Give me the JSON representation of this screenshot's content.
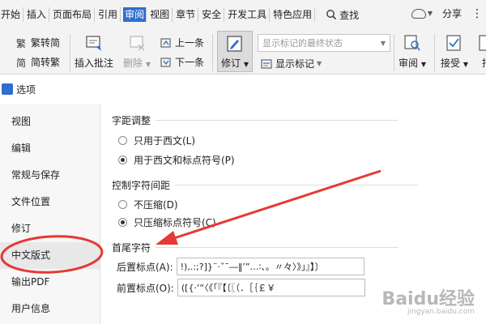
{
  "menubar": {
    "tabs": [
      "开始",
      "插入",
      "页面布局",
      "引用",
      "审阅",
      "视图",
      "章节",
      "安全",
      "开发工具",
      "特色应用"
    ],
    "active_tab": "审阅",
    "find_label": "查找",
    "share_label": "分享"
  },
  "toolbar": {
    "trad_to_simp": "繁转简",
    "simp_to_trad": "简转繁",
    "insert_comment": "插入批注",
    "delete": "删除",
    "previous": "上一条",
    "next": "下一条",
    "revise": "修订",
    "show_state_value": "显示标记的最终状态",
    "show_markup": "显示标记",
    "review": "审阅",
    "accept": "接受",
    "reject": "拒"
  },
  "dialog": {
    "title": "选项"
  },
  "sidebar": {
    "items": [
      "视图",
      "编辑",
      "常规与保存",
      "文件位置",
      "修订",
      "中文版式",
      "输出PDF",
      "用户信息"
    ],
    "selected": "中文版式"
  },
  "content": {
    "spacing": {
      "title": "字距调整",
      "options": [
        "只用于西文(L)",
        "用于西文和标点符号(P)"
      ],
      "selected_index": 1
    },
    "char_spacing": {
      "title": "控制字符间距",
      "options": [
        "不压缩(D)",
        "只压缩标点符号(C)"
      ],
      "selected_index": 1
    },
    "first_last": {
      "title": "首尾字符",
      "trailing_label": "后置标点(A):",
      "trailing_value": "!),.:;?]}¨·ˇˉ―‖’”…∶、。〃々〉》」』】〕",
      "leading_label": "前置标点(O):",
      "leading_value": "([{·‘“〈《「『【〔〖（．［｛￡￥"
    }
  },
  "watermark": {
    "text": "Baidu经验",
    "sub": "jingyan.baidu.com"
  },
  "annotation_color": "#e53935",
  "accent_color": "#2e6fcf"
}
